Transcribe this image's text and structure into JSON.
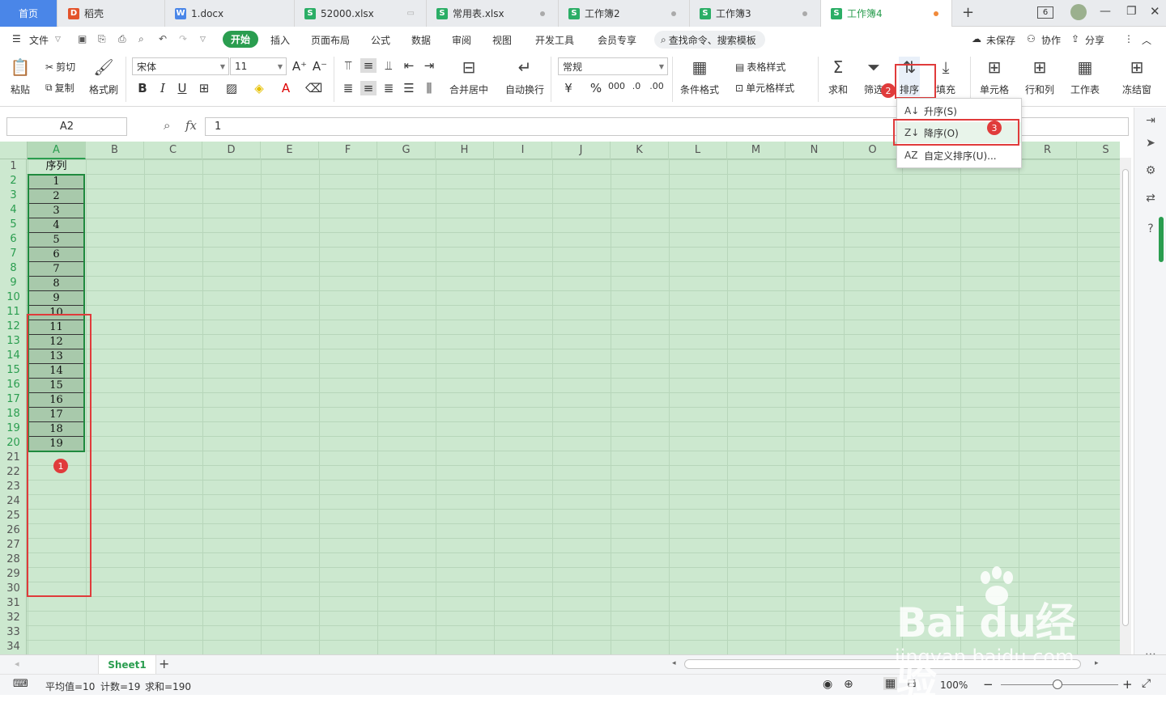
{
  "tabs": [
    {
      "label": "首页",
      "icon": "home-tab"
    },
    {
      "label": "稻壳",
      "icon": "docer-icon"
    },
    {
      "label": "1.docx",
      "icon": "word-icon"
    },
    {
      "label": "52000.xlsx",
      "icon": "sheet-icon"
    },
    {
      "label": "常用表.xlsx",
      "icon": "sheet-icon"
    },
    {
      "label": "工作簿2",
      "icon": "sheet-icon"
    },
    {
      "label": "工作簿3",
      "icon": "sheet-icon"
    },
    {
      "label": "工作簿4",
      "icon": "sheet-icon"
    }
  ],
  "window": {
    "tab_count": "6"
  },
  "menu": {
    "file": "文件",
    "start": "开始",
    "insert": "插入",
    "layout": "页面布局",
    "formula": "公式",
    "data": "数据",
    "review": "审阅",
    "view": "视图",
    "dev": "开发工具",
    "vip": "会员专享",
    "search": "查找命令、搜索模板",
    "unsaved": "未保存",
    "collab": "协作",
    "share": "分享"
  },
  "ribbon": {
    "paste": "粘贴",
    "cut": "剪切",
    "copy": "复制",
    "format_painter": "格式刷",
    "font_name": "宋体",
    "font_size": "11",
    "merge": "合并居中",
    "wrap": "自动换行",
    "number_format": "常规",
    "cond_format": "条件格式",
    "table_style": "表格样式",
    "cell_style": "单元格样式",
    "sum": "求和",
    "filter": "筛选",
    "sort": "排序",
    "fill": "填充",
    "cells": "单元格",
    "rowcol": "行和列",
    "sheet": "工作表",
    "freeze": "冻结窗"
  },
  "formula_bar": {
    "name_box": "A2",
    "fx": "fx",
    "value": "1"
  },
  "columns": [
    "A",
    "B",
    "C",
    "D",
    "E",
    "F",
    "G",
    "H",
    "I",
    "J",
    "K",
    "L",
    "M",
    "N",
    "O",
    "P",
    "Q",
    "R",
    "S"
  ],
  "rows": [
    "1",
    "2",
    "3",
    "4",
    "5",
    "6",
    "7",
    "8",
    "9",
    "10",
    "11",
    "12",
    "13",
    "14",
    "15",
    "16",
    "17",
    "18",
    "19",
    "20",
    "21",
    "22",
    "23",
    "24",
    "25",
    "26",
    "27",
    "28",
    "29",
    "30",
    "31",
    "32",
    "33",
    "34"
  ],
  "cells_a": [
    "序列",
    "1",
    "2",
    "3",
    "4",
    "5",
    "6",
    "7",
    "8",
    "9",
    "10",
    "11",
    "12",
    "13",
    "14",
    "15",
    "16",
    "17",
    "18",
    "19"
  ],
  "dropdown": {
    "ascending": "升序(S)",
    "descending": "降序(O)",
    "custom": "自定义排序(U)..."
  },
  "badges": [
    "1",
    "2",
    "3"
  ],
  "sheet_tab": "Sheet1",
  "status": {
    "average": "平均值=10",
    "count": "计数=19",
    "sum": "求和=190",
    "zoom": "100%"
  },
  "watermark": {
    "brand": "Bai du经验",
    "url": "jingyan.baidu.com"
  },
  "colors": {
    "accent": "#2a9d4f",
    "annotation": "#e03b3b",
    "grid": "#cce8cf"
  }
}
